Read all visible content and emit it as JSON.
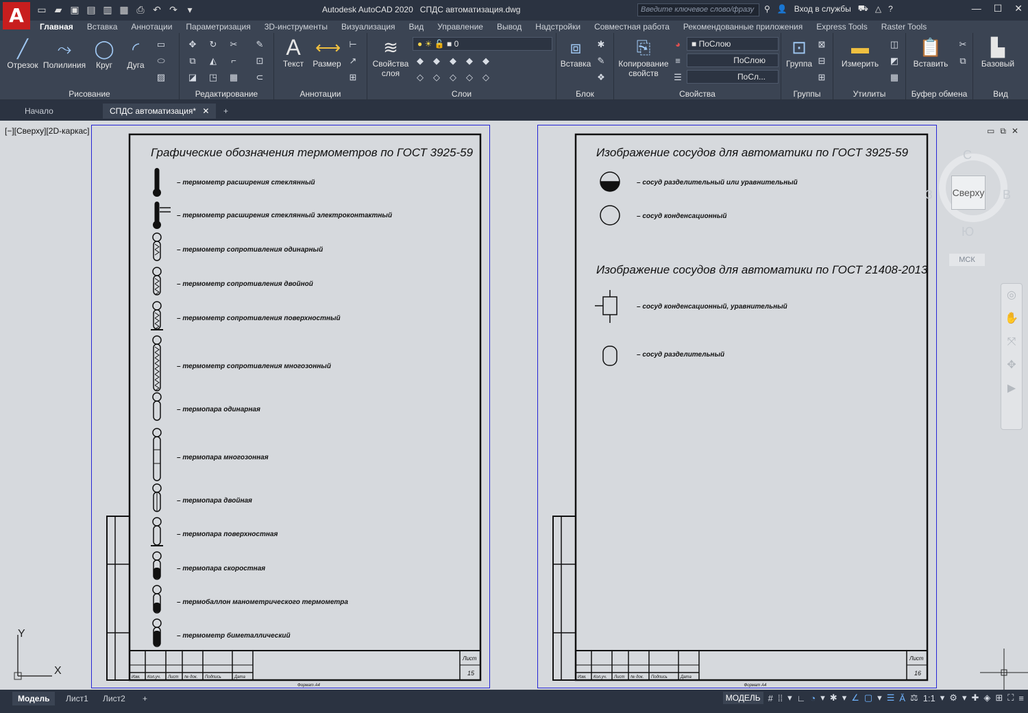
{
  "app": {
    "title": "Autodesk AutoCAD 2020",
    "file": "СПДС автоматизация.dwg",
    "logo": "A"
  },
  "titlebar": {
    "search_placeholder": "Введите ключевое слово/фразу",
    "login": "Вход в службы",
    "help_icon": "help-icon"
  },
  "ribbon_tabs": [
    "Главная",
    "Вставка",
    "Аннотации",
    "Параметризация",
    "3D-инструменты",
    "Визуализация",
    "Вид",
    "Управление",
    "Вывод",
    "Надстройки",
    "Совместная работа",
    "Рекомендованные приложения",
    "Express Tools",
    "Raster Tools"
  ],
  "ribbon": {
    "draw": {
      "title": "Рисование",
      "line": "Отрезок",
      "polyline": "Полилиния",
      "circle": "Круг",
      "arc": "Дуга"
    },
    "modify": {
      "title": "Редактирование"
    },
    "annotation": {
      "title": "Аннотации",
      "text": "Текст",
      "dimension": "Размер"
    },
    "layers": {
      "title": "Слои",
      "layer_props": "Свойства слоя",
      "current_layer": "0"
    },
    "block": {
      "title": "Блок",
      "insert": "Вставка"
    },
    "properties": {
      "title": "Свойства",
      "match": "Копирование свойств",
      "color": "ПоСлою",
      "linetype": "ПоСлою",
      "lineweight": "ПоСл..."
    },
    "groups": {
      "title": "Группы",
      "group": "Группа"
    },
    "utilities": {
      "title": "Утилиты",
      "measure": "Измерить"
    },
    "clipboard": {
      "title": "Буфер обмена",
      "paste": "Вставить"
    },
    "view": {
      "title": "Вид",
      "base": "Базовый"
    }
  },
  "doc_tabs": {
    "start": "Начало",
    "active": "СПДС автоматизация*",
    "add": "+"
  },
  "viewport": {
    "label": "[−][Сверху][2D-каркас]",
    "viewcube_face": "Сверху",
    "compass": {
      "n": "С",
      "s": "Ю",
      "w": "З",
      "e": "В"
    },
    "wcs": "МСК",
    "ucs_x": "X",
    "ucs_y": "Y"
  },
  "sheet1": {
    "title": "Графические обозначения термометров по ГОСТ 3925-59",
    "items": [
      "– термометр расширения стеклянный",
      "– термометр расширения стеклянный электроконтактный",
      "– термометр сопротивления одинарный",
      "– термометр сопротивления двойной",
      "– термометр сопротивления поверхностный",
      "– термометр сопротивления многозонный",
      "– термопара одинарная",
      "– термопара многозонная",
      "– термопара двойная",
      "– термопара поверхностная",
      "– термопара скоростная",
      "– термобаллон манометрического термометра",
      "– термометр биметаллический"
    ],
    "stamp_sheet": "Лист",
    "stamp_number": "15",
    "format": "Формат А4",
    "stamp_cols": [
      "Изм.",
      "Кол.уч.",
      "Лист",
      "№ док.",
      "Подпись",
      "Дата"
    ]
  },
  "sheet2": {
    "title1": "Изображение сосудов для автоматики по ГОСТ 3925-59",
    "items1": [
      "– сосуд разделительный или уравнительный",
      "– сосуд конденсационный"
    ],
    "title2": "Изображение сосудов для автоматики по ГОСТ 21408-2013",
    "items2": [
      "– сосуд конденсационный, уравнительный",
      "– сосуд разделительный"
    ],
    "stamp_sheet": "Лист",
    "stamp_number": "16",
    "format": "Формат А4",
    "stamp_cols": [
      "Изм.",
      "Кол.уч.",
      "Лист",
      "№ док.",
      "Подпись",
      "Дата"
    ]
  },
  "layout_tabs": [
    "Модель",
    "Лист1",
    "Лист2"
  ],
  "status": {
    "model": "МОДЕЛЬ",
    "scale": "1:1"
  }
}
